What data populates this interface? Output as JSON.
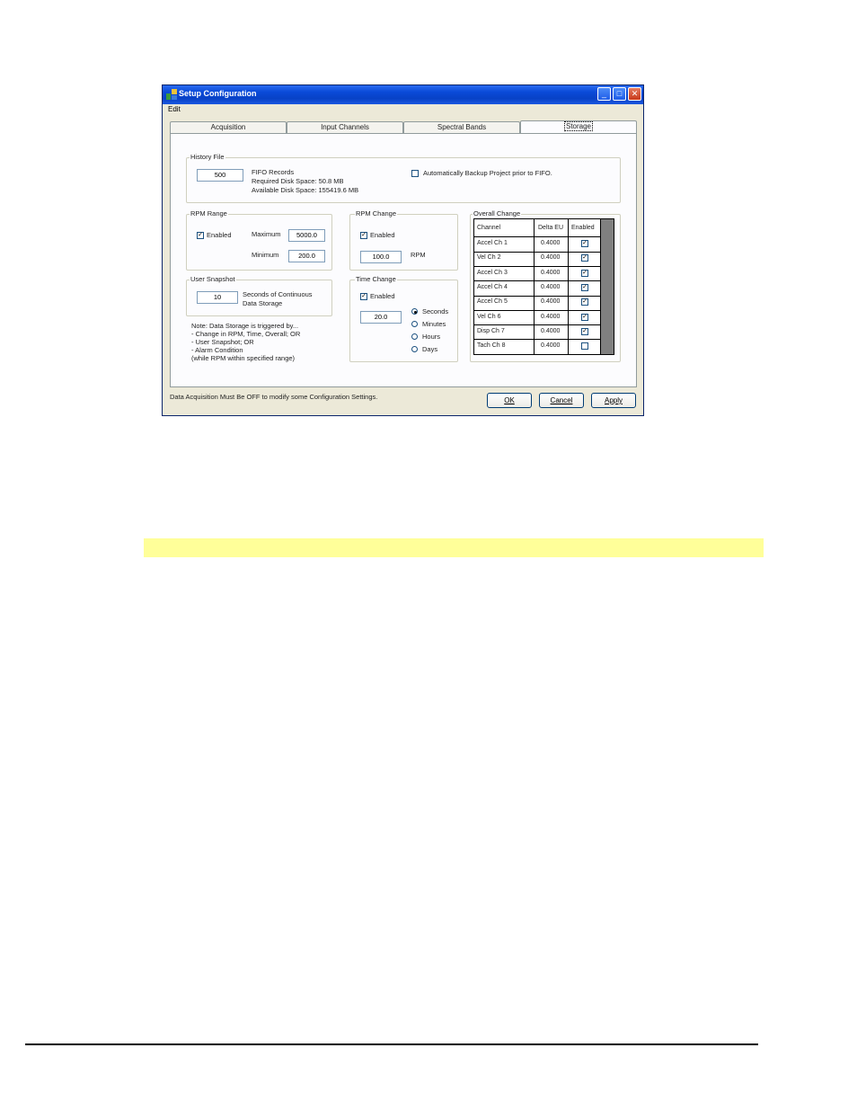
{
  "window": {
    "title": "Setup Configuration",
    "menu_edit": "Edit",
    "min_glyph": "_",
    "max_glyph": "□",
    "close_glyph": "✕"
  },
  "tabs": [
    {
      "label": "Acquisition"
    },
    {
      "label": "Input Channels"
    },
    {
      "label": "Spectral Bands"
    },
    {
      "label": "Storage",
      "active": true
    }
  ],
  "history_file": {
    "group_label": "History File",
    "fifo_records_value": "500",
    "fifo_records_label": "FIFO Records",
    "required_disk_space": "Required Disk Space:  50.8 MB",
    "available_disk_space": "Available Disk Space: 155419.6 MB",
    "auto_backup_label": "Automatically Backup Project prior to FIFO.",
    "auto_backup_checked": false
  },
  "rpm_range": {
    "group_label": "RPM Range",
    "enabled_label": "Enabled",
    "enabled_checked": true,
    "maximum_label": "Maximum",
    "maximum_value": "5000.0",
    "minimum_label": "Minimum",
    "minimum_value": "200.0"
  },
  "rpm_change": {
    "group_label": "RPM Change",
    "enabled_label": "Enabled",
    "enabled_checked": true,
    "value": "100.0",
    "unit": "RPM"
  },
  "user_snapshot": {
    "group_label": "User Snapshot",
    "value": "10",
    "label_line1": "Seconds of Continuous",
    "label_line2": "Data Storage"
  },
  "time_change": {
    "group_label": "Time Change",
    "enabled_label": "Enabled",
    "enabled_checked": true,
    "value": "20.0",
    "units": [
      "Seconds",
      "Minutes",
      "Hours",
      "Days"
    ],
    "selected_unit": "Seconds"
  },
  "note": {
    "line1": "Note:  Data Storage is triggered by...",
    "line2": "- Change in RPM, Time, Overall;  OR",
    "line3": "- User Snapshot;  OR",
    "line4": "- Alarm Condition",
    "line5": "(while RPM within specified range)"
  },
  "overall_change": {
    "group_label": "Overall Change",
    "headers": {
      "channel": "Channel",
      "delta": "Delta EU",
      "enabled": "Enabled"
    },
    "rows": [
      {
        "channel": "Accel Ch 1",
        "delta": "0.4000",
        "enabled": true
      },
      {
        "channel": "Vel Ch  2",
        "delta": "0.4000",
        "enabled": true
      },
      {
        "channel": "Accel Ch  3",
        "delta": "0.4000",
        "enabled": true
      },
      {
        "channel": "Accel Ch  4",
        "delta": "0.4000",
        "enabled": true
      },
      {
        "channel": "Accel Ch  5",
        "delta": "0.4000",
        "enabled": true
      },
      {
        "channel": "Vel Ch  6",
        "delta": "0.4000",
        "enabled": true
      },
      {
        "channel": "Disp Ch  7",
        "delta": "0.4000",
        "enabled": true
      },
      {
        "channel": "Tach Ch  8",
        "delta": "0.4000",
        "enabled": false
      }
    ]
  },
  "status_text": "Data Acquisition Must Be OFF to modify some Configuration Settings.",
  "buttons": {
    "ok": "OK",
    "cancel": "Cancel",
    "apply": "Apply"
  },
  "check_glyph": "✓",
  "colors": {
    "titlebar": "#0a4ad8",
    "highlight": "#ffff99",
    "dialog": "#ece9d8"
  }
}
